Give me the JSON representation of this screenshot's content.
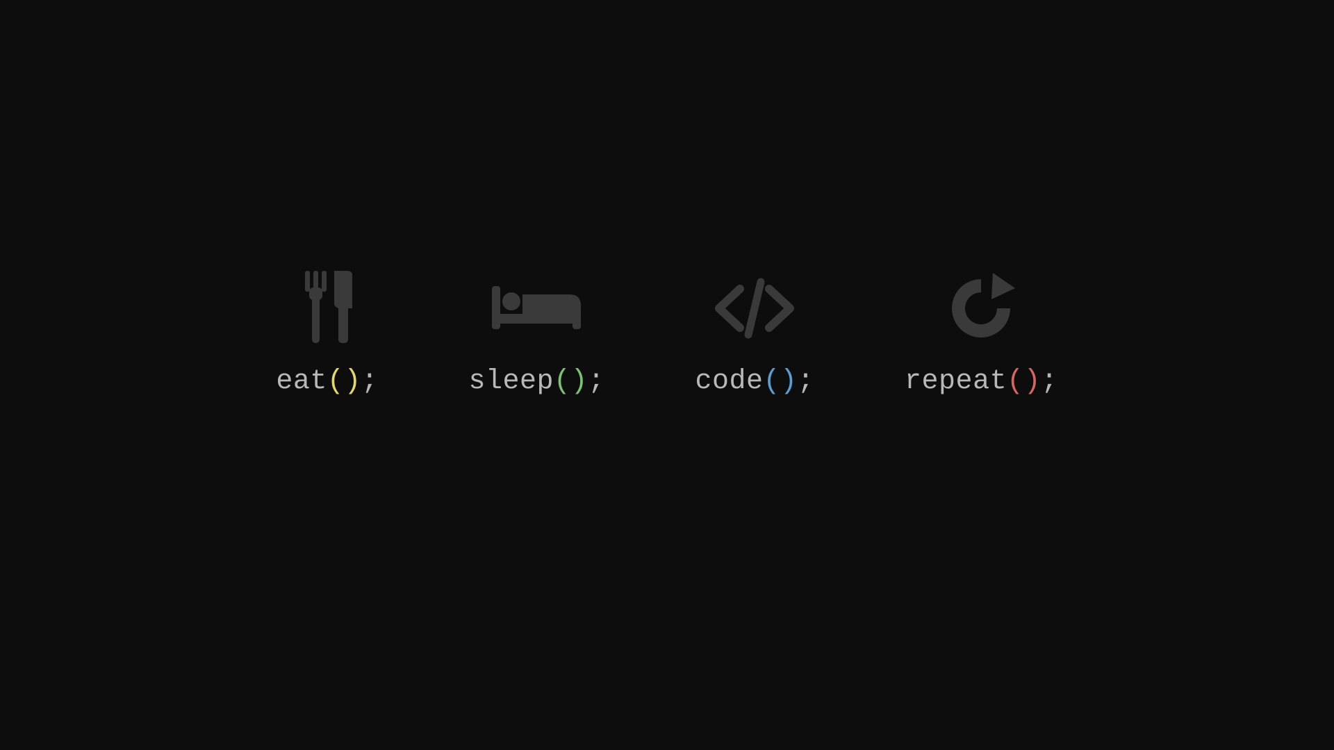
{
  "items": [
    {
      "fn": "eat",
      "parens": "()",
      "semi": ";"
    },
    {
      "fn": "sleep",
      "parens": "()",
      "semi": ";"
    },
    {
      "fn": "code",
      "parens": "()",
      "semi": ";"
    },
    {
      "fn": "repeat",
      "parens": "()",
      "semi": ";"
    }
  ]
}
